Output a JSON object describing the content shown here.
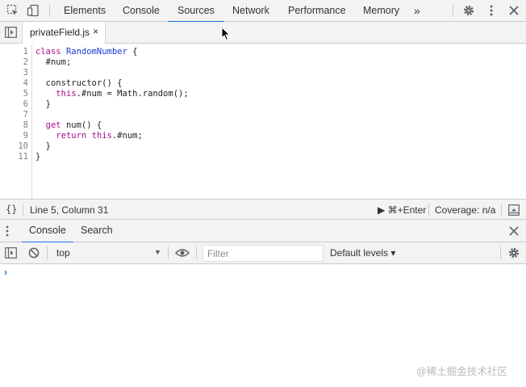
{
  "main_tabs": [
    "Elements",
    "Console",
    "Sources",
    "Network",
    "Performance",
    "Memory"
  ],
  "active_main_tab": "Sources",
  "more_tabs_glyph": "»",
  "file_tab": {
    "name": "privateField.js",
    "close_glyph": "×"
  },
  "editor": {
    "line_numbers": [
      "1",
      "2",
      "3",
      "4",
      "5",
      "6",
      "7",
      "8",
      "9",
      "10",
      "11"
    ]
  },
  "status": {
    "braces": "{}",
    "position": "Line 5, Column 31",
    "run_shortcut": "▶ ⌘+Enter",
    "coverage": "Coverage: n/a"
  },
  "drawer_tabs": {
    "console": "Console",
    "search": "Search"
  },
  "console_toolbar": {
    "context": "top",
    "filter_placeholder": "Filter",
    "levels": "Default levels ▾"
  },
  "console": {
    "prompt": "›"
  },
  "watermark": "@稀土掘金技术社区",
  "colors": {
    "accent": "#1a73e8",
    "keyword": "#aa0d91",
    "toolbar_bg": "#f3f3f3"
  },
  "icons": [
    "inspect-element-icon",
    "device-toggle-icon",
    "settings-gear-icon",
    "kebab-menu-icon",
    "close-icon",
    "sidebar-toggle-icon",
    "clear-console-icon",
    "eye-icon",
    "dock-drawer-icon"
  ]
}
